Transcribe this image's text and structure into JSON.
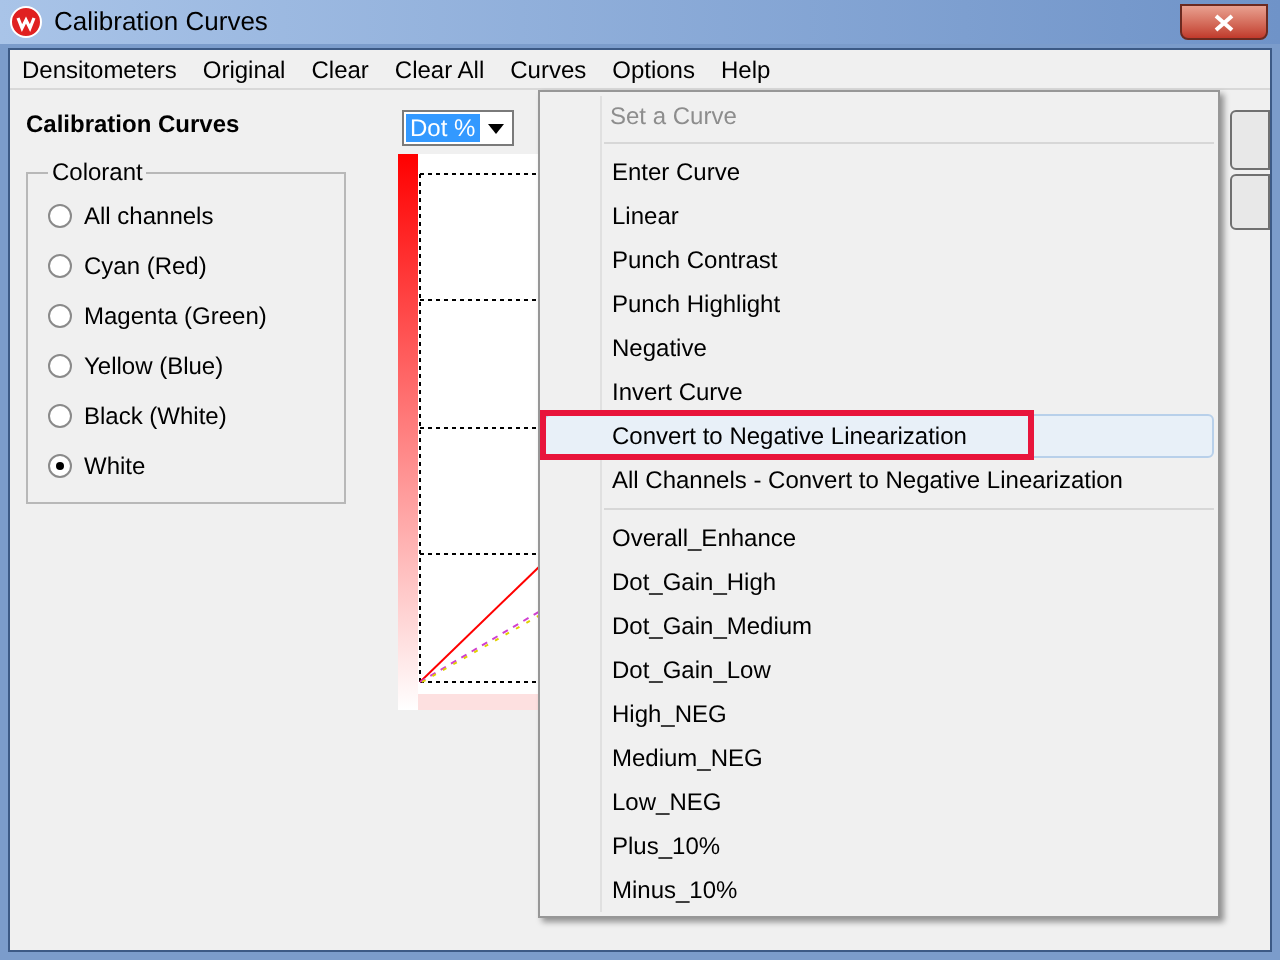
{
  "window": {
    "title": "Calibration Curves"
  },
  "menubar": [
    "Densitometers",
    "Original",
    "Clear",
    "Clear All",
    "Curves",
    "Options",
    "Help"
  ],
  "panel_title": "Calibration Curves",
  "unit_select": {
    "value": "Dot %"
  },
  "colorant": {
    "label": "Colorant",
    "options": [
      {
        "label": "All channels",
        "selected": false
      },
      {
        "label": "Cyan (Red)",
        "selected": false
      },
      {
        "label": "Magenta (Green)",
        "selected": false
      },
      {
        "label": "Yellow (Blue)",
        "selected": false
      },
      {
        "label": "Black (White)",
        "selected": false
      },
      {
        "label": "White",
        "selected": true
      }
    ]
  },
  "curves_menu": {
    "header": "Set a Curve",
    "groups": [
      [
        {
          "label": "Enter Curve",
          "selected": false,
          "marked": false
        },
        {
          "label": "Linear",
          "selected": false,
          "marked": false
        },
        {
          "label": "Punch Contrast",
          "selected": false,
          "marked": false
        },
        {
          "label": "Punch Highlight",
          "selected": false,
          "marked": false
        },
        {
          "label": "Negative",
          "selected": false,
          "marked": false
        },
        {
          "label": "Invert Curve",
          "selected": false,
          "marked": false
        },
        {
          "label": "Convert to Negative Linearization",
          "selected": true,
          "marked": true
        },
        {
          "label": "All Channels - Convert to Negative Linearization",
          "selected": false,
          "marked": false
        }
      ],
      [
        {
          "label": "Overall_Enhance",
          "selected": false,
          "marked": false
        },
        {
          "label": "Dot_Gain_High",
          "selected": false,
          "marked": false
        },
        {
          "label": "Dot_Gain_Medium",
          "selected": false,
          "marked": false
        },
        {
          "label": "Dot_Gain_Low",
          "selected": false,
          "marked": false
        },
        {
          "label": "High_NEG",
          "selected": false,
          "marked": false
        },
        {
          "label": "Medium_NEG",
          "selected": false,
          "marked": false
        },
        {
          "label": "Low_NEG",
          "selected": false,
          "marked": false
        },
        {
          "label": "Plus_10%",
          "selected": false,
          "marked": false
        },
        {
          "label": "Minus_10%",
          "selected": false,
          "marked": false
        }
      ]
    ]
  }
}
